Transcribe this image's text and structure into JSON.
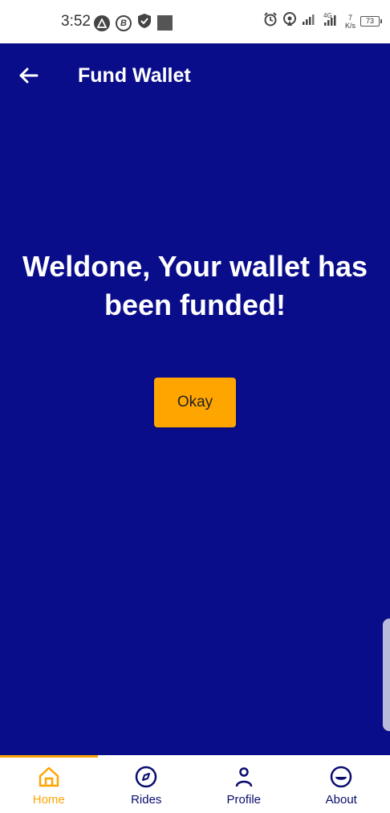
{
  "status_bar": {
    "time": "3:52",
    "battery": "73",
    "net_speed_top": "7",
    "net_speed_unit": "K/s",
    "network_type": "4G"
  },
  "header": {
    "title": "Fund Wallet",
    "back_icon": "arrow-left-icon"
  },
  "main": {
    "message": "Weldone, Your wallet has been funded!",
    "okay_label": "Okay"
  },
  "colors": {
    "primary": "#0a0d8a",
    "accent": "#ffa500",
    "text_light": "#ffffff",
    "nav_text": "#0a0d6e"
  },
  "bottom_nav": {
    "items": [
      {
        "label": "Home",
        "icon": "home-icon",
        "active": true
      },
      {
        "label": "Rides",
        "icon": "compass-icon",
        "active": false
      },
      {
        "label": "Profile",
        "icon": "person-icon",
        "active": false
      },
      {
        "label": "About",
        "icon": "smiley-icon",
        "active": false
      }
    ]
  }
}
